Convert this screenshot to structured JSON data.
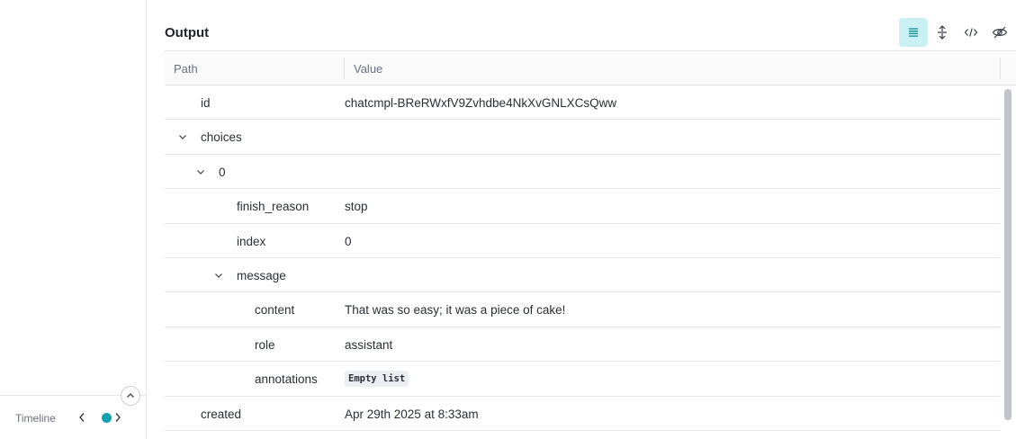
{
  "left": {
    "timeline_label": "Timeline"
  },
  "output": {
    "title": "Output",
    "toolbar": [
      {
        "name": "list-view-icon",
        "active": true
      },
      {
        "name": "expand-collapse-icon",
        "active": false
      },
      {
        "name": "code-view-icon",
        "active": false
      },
      {
        "name": "hide-icon",
        "active": false
      }
    ],
    "columns": {
      "path": "Path",
      "value": "Value"
    },
    "rows": [
      {
        "key": "id",
        "value": "chatcmpl-BReRWxfV9Zvhdbe4NkXvGNLXCsQww",
        "depth": 1,
        "expandable": false
      },
      {
        "key": "choices",
        "value": "",
        "depth": 0,
        "expandable": true
      },
      {
        "key": "0",
        "value": "",
        "depth": 1,
        "expandable": true
      },
      {
        "key": "finish_reason",
        "value": "stop",
        "depth": 3,
        "expandable": false
      },
      {
        "key": "index",
        "value": "0",
        "depth": 3,
        "expandable": false
      },
      {
        "key": "message",
        "value": "",
        "depth": 2,
        "expandable": true
      },
      {
        "key": "content",
        "value": "That was so easy; it was a piece of cake!",
        "depth": 4,
        "expandable": false
      },
      {
        "key": "role",
        "value": "assistant",
        "depth": 4,
        "expandable": false
      },
      {
        "key": "annotations",
        "value": "Empty list",
        "depth": 4,
        "expandable": false,
        "badge": true
      },
      {
        "key": "created",
        "value": "Apr 29th 2025 at 8:33am",
        "depth": 1,
        "expandable": false
      }
    ]
  },
  "colors": {
    "accent": "#13a3b0",
    "active_bg": "#c9f1f4"
  }
}
